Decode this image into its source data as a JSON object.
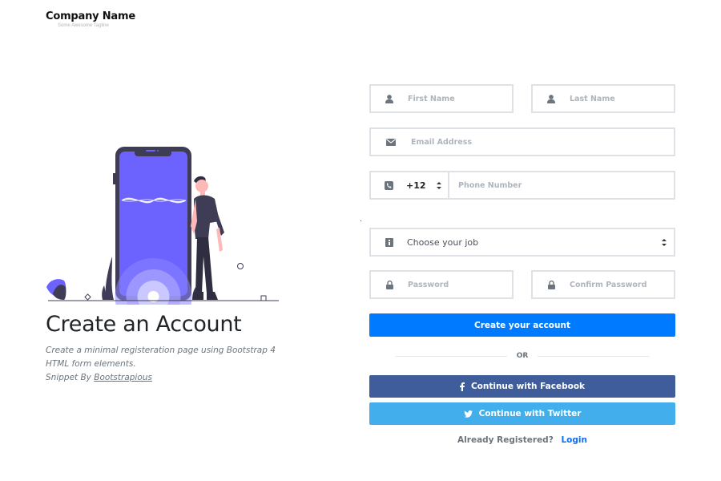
{
  "brand": {
    "name": "Company Name",
    "tagline": "Some Awesome Tagline"
  },
  "hero": {
    "title": "Create an Account",
    "description": "Create a minimal registeration page using Bootstrap 4 HTML form elements.",
    "snippet_prefix": "Snippet By ",
    "snippet_link": "Bootstrapious"
  },
  "form": {
    "first_name": {
      "placeholder": "First Name",
      "icon": "user-icon"
    },
    "last_name": {
      "placeholder": "Last Name",
      "icon": "user-icon"
    },
    "email": {
      "placeholder": "Email Address",
      "icon": "envelope-icon"
    },
    "phone": {
      "country_code": "+12",
      "placeholder": "Phone Number",
      "icon": "phone-square-icon"
    },
    "job": {
      "selected": "Choose your job",
      "icon": "id-badge-icon"
    },
    "password": {
      "placeholder": "Password",
      "icon": "lock-icon"
    },
    "confirm_password": {
      "placeholder": "Confirm Password",
      "icon": "lock-icon"
    },
    "submit_label": "Create your account",
    "divider_label": "OR",
    "facebook_label": "Continue with Facebook",
    "twitter_label": "Continue with Twitter",
    "login_prompt": "Already Registered?",
    "login_link": "Login"
  },
  "colors": {
    "primary": "#007bff",
    "facebook": "#405d9b",
    "twitter": "#42aeec",
    "illustration_accent": "#6c63ff",
    "phone_body": "#3f3d56"
  }
}
